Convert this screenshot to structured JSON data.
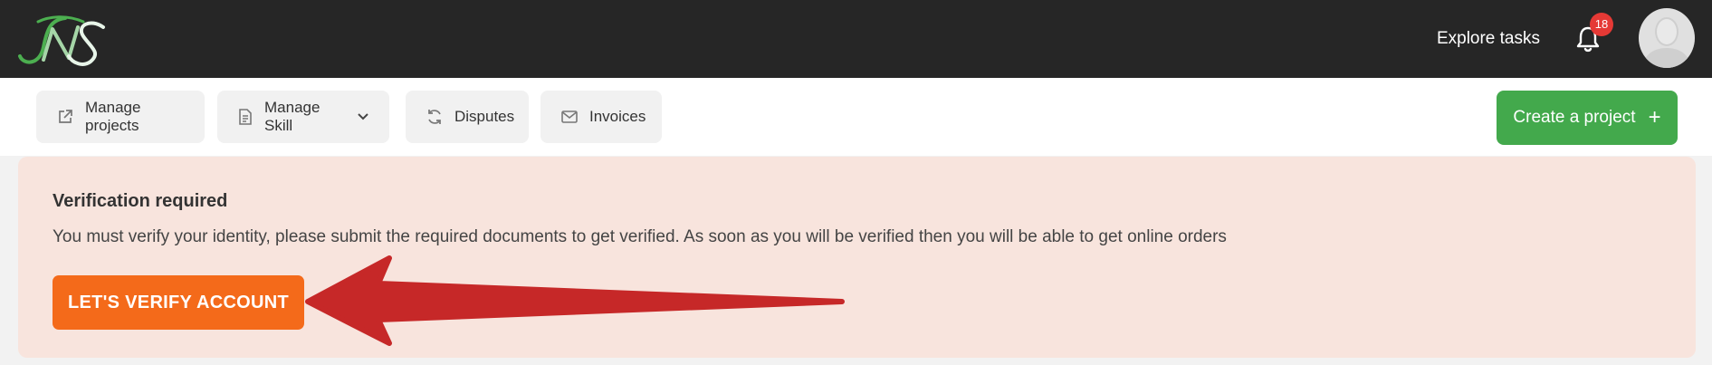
{
  "header": {
    "logo_text": "NS",
    "explore_label": "Explore tasks",
    "notification_count": "18"
  },
  "toolbar": {
    "buttons": [
      {
        "label": "Manage projects",
        "icon": "external-link-icon"
      },
      {
        "label": "Manage Skill",
        "icon": "document-icon"
      },
      {
        "label": "Disputes",
        "icon": "refresh-icon"
      },
      {
        "label": "Invoices",
        "icon": "mail-icon"
      }
    ],
    "create_label": "Create a project",
    "create_icon": "plus-icon"
  },
  "alert": {
    "title": "Verification required",
    "message": "You must verify your identity, please submit the required documents to get verified. As soon as you will be verified then you will be able to get online orders",
    "button_label": "LET'S VERIFY ACCOUNT"
  },
  "colors": {
    "topbar": "#262626",
    "primary_green": "#43a94c",
    "alert_bg": "#f8e4dd",
    "verify_orange": "#f46a1a",
    "arrow_red": "#c62828",
    "badge_red": "#e53935"
  }
}
